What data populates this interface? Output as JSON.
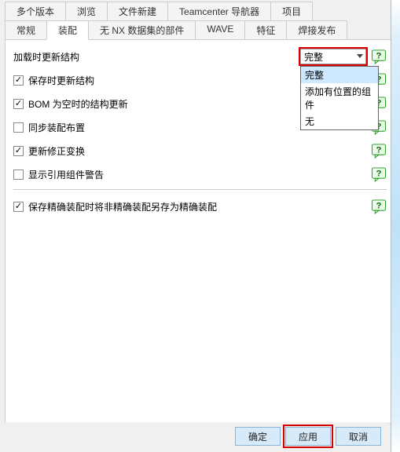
{
  "tabs_row1": [
    {
      "label": "多个版本"
    },
    {
      "label": "浏览"
    },
    {
      "label": "文件新建"
    },
    {
      "label": "Teamcenter 导航器"
    },
    {
      "label": "项目"
    }
  ],
  "tabs_row2": [
    {
      "label": "常规"
    },
    {
      "label": "装配",
      "active": true
    },
    {
      "label": "无 NX 数据集的部件"
    },
    {
      "label": "WAVE"
    },
    {
      "label": "特征"
    },
    {
      "label": "焊接发布"
    }
  ],
  "options": {
    "load_update_structure": "加载时更新结构",
    "save_update_structure": "保存时更新结构",
    "bom_empty_update": "BOM 为空时的结构更新",
    "sync_assembly_layout": "同步装配布置",
    "update_revision_transform": "更新修正变换",
    "show_ref_component_warning": "显示引用组件警告",
    "save_precise_assembly": "保存精确装配时将非精确装配另存为精确装配"
  },
  "checkbox_states": {
    "save_update_structure": true,
    "bom_empty_update": true,
    "sync_assembly_layout": false,
    "update_revision_transform": true,
    "show_ref_component_warning": false,
    "save_precise_assembly": true
  },
  "dropdown": {
    "selected": "完整",
    "options": [
      "完整",
      "添加有位置的组件",
      "无"
    ]
  },
  "footer": {
    "ok": "确定",
    "apply": "应用",
    "cancel": "取消"
  }
}
